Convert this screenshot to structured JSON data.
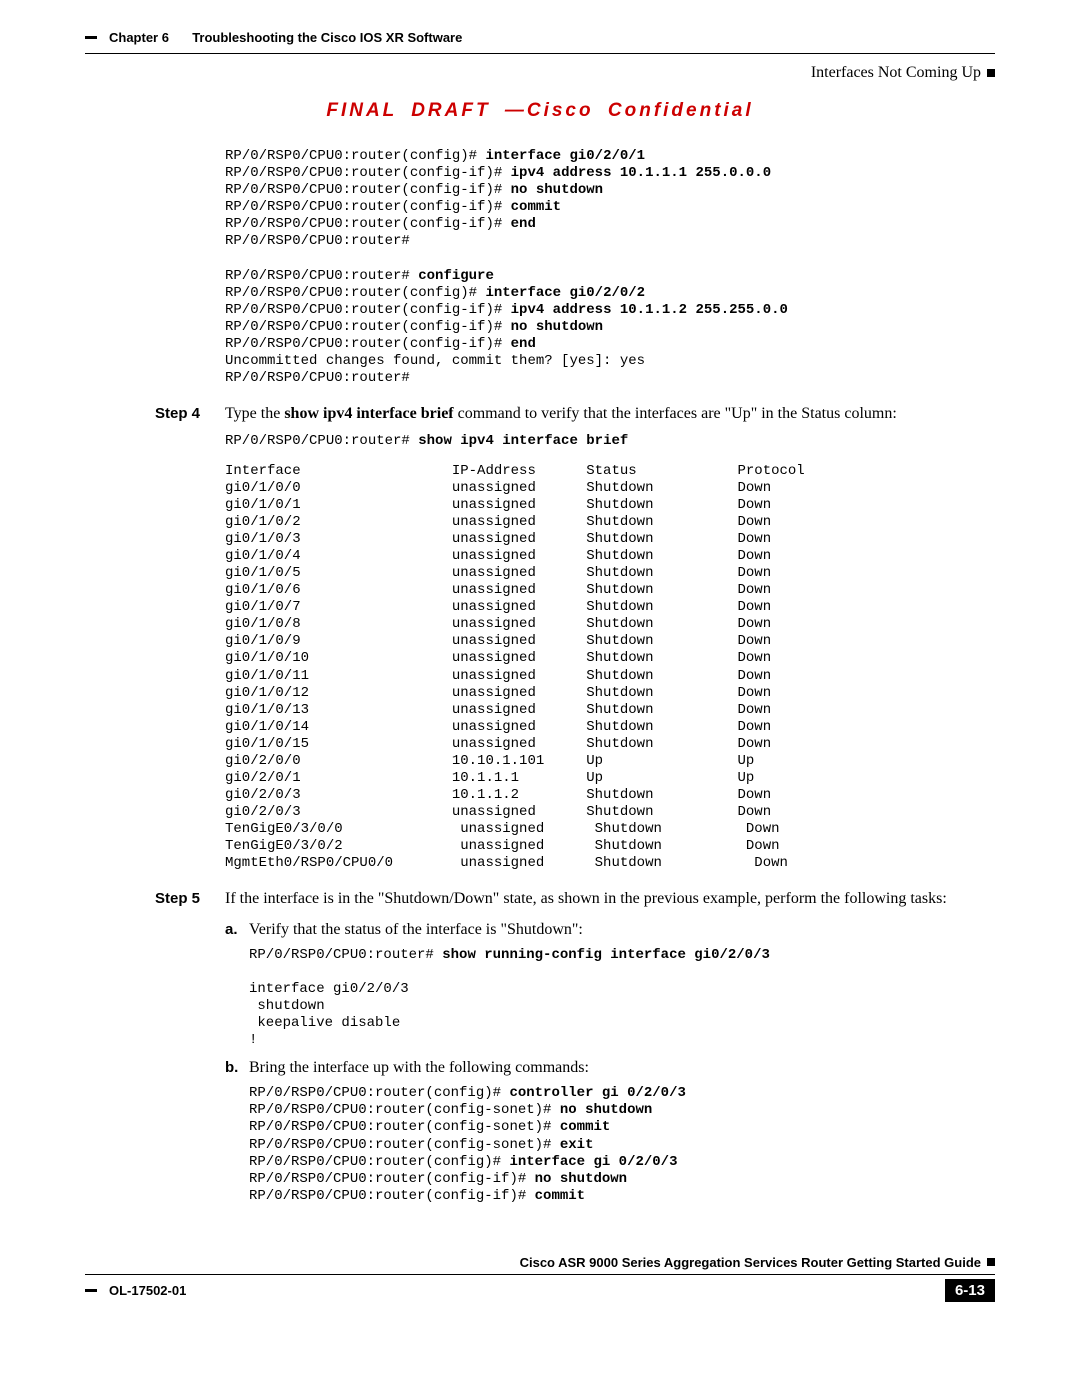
{
  "header": {
    "chapter_label": "Chapter 6",
    "chapter_title": "Troubleshooting the Cisco IOS XR Software",
    "section": "Interfaces Not Coming Up"
  },
  "draft_title": "FINAL DRAFT —Cisco Confidential",
  "code_block1": [
    {
      "prompt": "RP/0/RSP0/CPU0:router(config)# ",
      "cmd": "interface gi0/2/0/1"
    },
    {
      "prompt": "RP/0/RSP0/CPU0:router(config-if)# ",
      "cmd": "ipv4 address 10.1.1.1 255.0.0.0"
    },
    {
      "prompt": "RP/0/RSP0/CPU0:router(config-if)# ",
      "cmd": "no shutdown"
    },
    {
      "prompt": "RP/0/RSP0/CPU0:router(config-if)# ",
      "cmd": "commit"
    },
    {
      "prompt": "RP/0/RSP0/CPU0:router(config-if)# ",
      "cmd": "end"
    },
    {
      "prompt": "RP/0/RSP0/CPU0:router#",
      "cmd": ""
    },
    {
      "prompt": "",
      "cmd": ""
    },
    {
      "prompt": "RP/0/RSP0/CPU0:router# ",
      "cmd": "configure"
    },
    {
      "prompt": "RP/0/RSP0/CPU0:router(config)# ",
      "cmd": "interface gi0/2/0/2"
    },
    {
      "prompt": "RP/0/RSP0/CPU0:router(config-if)# ",
      "cmd": "ipv4 address 10.1.1.2 255.255.0.0"
    },
    {
      "prompt": "RP/0/RSP0/CPU0:router(config-if)# ",
      "cmd": "no shutdown"
    },
    {
      "prompt": "RP/0/RSP0/CPU0:router(config-if)# ",
      "cmd": "end"
    },
    {
      "prompt": "Uncommitted changes found, commit them? [yes]: yes",
      "cmd": ""
    },
    {
      "prompt": "RP/0/RSP0/CPU0:router#",
      "cmd": ""
    }
  ],
  "step4": {
    "label": "Step 4",
    "text_pre": "Type the ",
    "text_cmd": "show ipv4 interface brief",
    "text_post": " command to verify that the interfaces are \"Up\" in the Status column:"
  },
  "show_cmd": {
    "prompt": "RP/0/RSP0/CPU0:router# ",
    "cmd": "show ipv4 interface brief"
  },
  "if_table": {
    "headers": [
      "Interface",
      "IP-Address",
      "Status",
      "Protocol"
    ],
    "rows": [
      [
        "gi0/1/0/0",
        "unassigned",
        "Shutdown",
        "Down"
      ],
      [
        "gi0/1/0/1",
        "unassigned",
        "Shutdown",
        "Down"
      ],
      [
        "gi0/1/0/2",
        "unassigned",
        "Shutdown",
        "Down"
      ],
      [
        "gi0/1/0/3",
        "unassigned",
        "Shutdown",
        "Down"
      ],
      [
        "gi0/1/0/4",
        "unassigned",
        "Shutdown",
        "Down"
      ],
      [
        "gi0/1/0/5",
        "unassigned",
        "Shutdown",
        "Down"
      ],
      [
        "gi0/1/0/6",
        "unassigned",
        "Shutdown",
        "Down"
      ],
      [
        "gi0/1/0/7",
        "unassigned",
        "Shutdown",
        "Down"
      ],
      [
        "gi0/1/0/8",
        "unassigned",
        "Shutdown",
        "Down"
      ],
      [
        "gi0/1/0/9",
        "unassigned",
        "Shutdown",
        "Down"
      ],
      [
        "gi0/1/0/10",
        "unassigned",
        "Shutdown",
        "Down"
      ],
      [
        "gi0/1/0/11",
        "unassigned",
        "Shutdown",
        "Down"
      ],
      [
        "gi0/1/0/12",
        "unassigned",
        "Shutdown",
        "Down"
      ],
      [
        "gi0/1/0/13",
        "unassigned",
        "Shutdown",
        "Down"
      ],
      [
        "gi0/1/0/14",
        "unassigned",
        "Shutdown",
        "Down"
      ],
      [
        "gi0/1/0/15",
        "unassigned",
        "Shutdown",
        "Down"
      ],
      [
        "gi0/2/0/0",
        "10.10.1.101",
        "Up",
        "Up"
      ],
      [
        "gi0/2/0/1",
        "10.1.1.1",
        "Up",
        "Up"
      ],
      [
        "gi0/2/0/3",
        "10.1.1.2",
        "Shutdown",
        "Down"
      ],
      [
        "gi0/2/0/3",
        "unassigned",
        "Shutdown",
        "Down"
      ],
      [
        "TenGigE0/3/0/0",
        " unassigned",
        " Shutdown",
        " Down"
      ],
      [
        "TenGigE0/3/0/2",
        " unassigned",
        " Shutdown",
        " Down"
      ],
      [
        "MgmtEth0/RSP0/CPU0/0",
        " unassigned",
        " Shutdown",
        "  Down"
      ]
    ]
  },
  "step5": {
    "label": "Step 5",
    "text": "If the interface is in the \"Shutdown/Down\" state, as shown in the previous example, perform the following tasks:"
  },
  "sub_a": {
    "label": "a.",
    "text": "Verify that the status of the interface is \"Shutdown\":"
  },
  "code_a": [
    {
      "prompt": "RP/0/RSP0/CPU0:router# ",
      "cmd": "show running-config interface gi0/2/0/3"
    },
    {
      "prompt": "",
      "cmd": ""
    },
    {
      "prompt": "interface gi0/2/0/3",
      "cmd": ""
    },
    {
      "prompt": " shutdown",
      "cmd": ""
    },
    {
      "prompt": " keepalive disable",
      "cmd": ""
    },
    {
      "prompt": "!",
      "cmd": ""
    }
  ],
  "sub_b": {
    "label": "b.",
    "text": "Bring the interface up with the following commands:"
  },
  "code_b": [
    {
      "prompt": "RP/0/RSP0/CPU0:router(config)# ",
      "cmd": "controller gi 0/2/0/3"
    },
    {
      "prompt": "RP/0/RSP0/CPU0:router(config-sonet)# ",
      "cmd": "no shutdown"
    },
    {
      "prompt": "RP/0/RSP0/CPU0:router(config-sonet)# ",
      "cmd": "commit"
    },
    {
      "prompt": "RP/0/RSP0/CPU0:router(config-sonet)# ",
      "cmd": "exit"
    },
    {
      "prompt": "RP/0/RSP0/CPU0:router(config)# ",
      "cmd": "interface gi 0/2/0/3"
    },
    {
      "prompt": "RP/0/RSP0/CPU0:router(config-if)# ",
      "cmd": "no shutdown"
    },
    {
      "prompt": "RP/0/RSP0/CPU0:router(config-if)# ",
      "cmd": "commit"
    }
  ],
  "footer": {
    "guide": "Cisco ASR 9000 Series Aggregation Services Router Getting Started Guide",
    "doc_id": "OL-17502-01",
    "page_num": "6-13"
  }
}
